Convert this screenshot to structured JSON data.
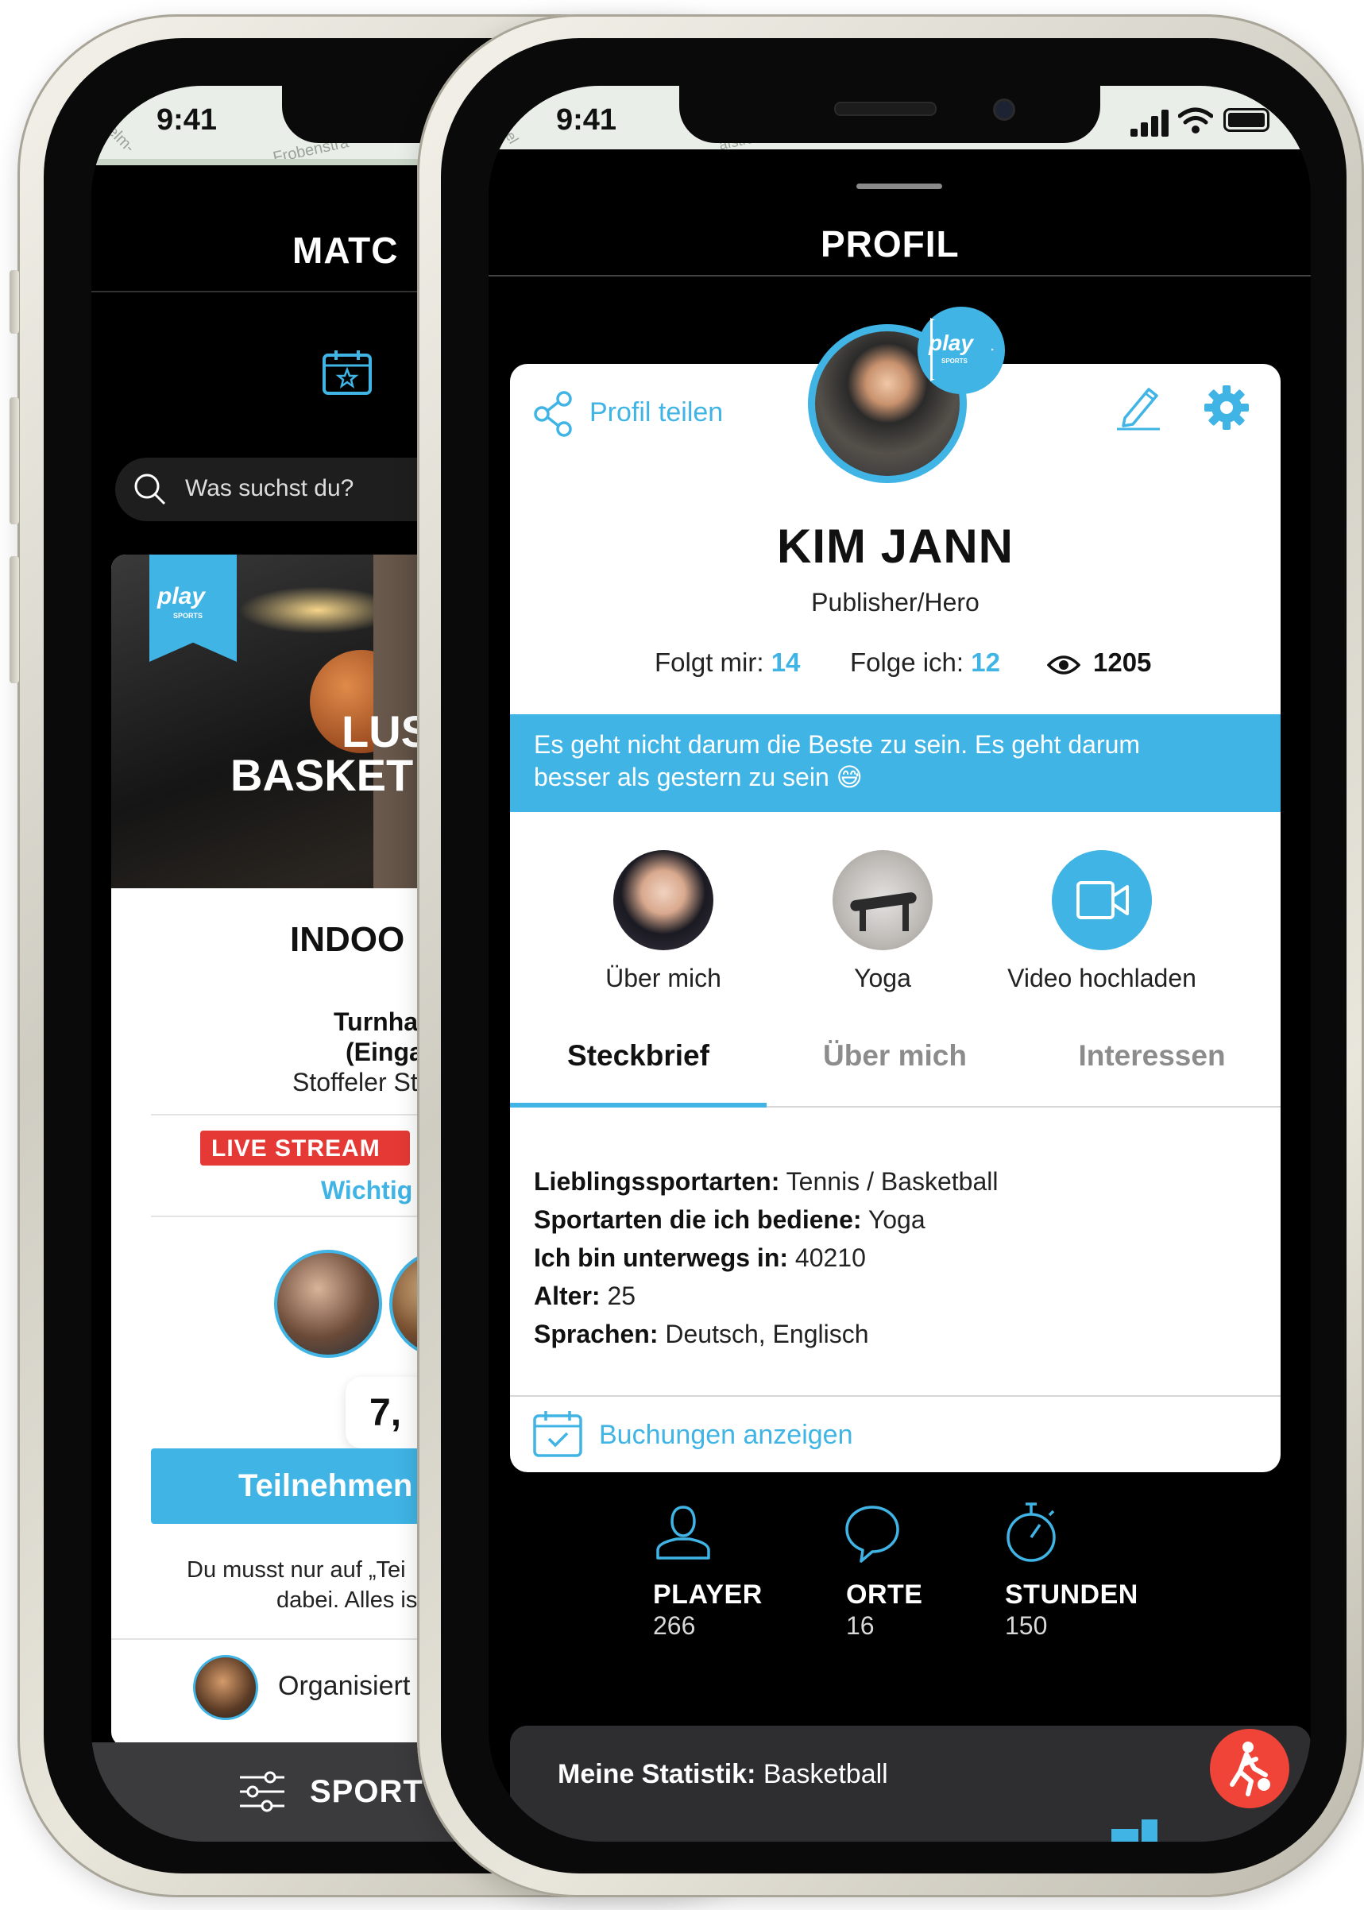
{
  "back_phone": {
    "status_time": "9:41",
    "map_labels": [
      "helm-",
      "Frobenstra"
    ],
    "header_title": "MATC",
    "search_placeholder": "Was suchst du?",
    "hero_line1": "LUS",
    "hero_line2": "BASKET",
    "event_title": "INDOO",
    "venue_line1": "Turnha",
    "venue_line2": "(Einga",
    "venue_line3": "Stoffeler St",
    "live_badge": "LIVE STREAM",
    "important_link": "Wichtig",
    "price": "7,",
    "join_button": "Teilnehmen",
    "hint_line1": "Du musst nur auf „Tei",
    "hint_line2": "dabei. Alles is",
    "organizer": "Organisiert v",
    "bottom_nav_label": "SPORT"
  },
  "front_phone": {
    "status_time": "9:41",
    "map_labels": [
      "rhel",
      "afstra"
    ],
    "header_title": "PROFIL",
    "share_label": "Profil teilen",
    "name": "KIM JANN",
    "role": "Publisher/Hero",
    "followers_label": "Folgt mir:",
    "followers_count": "14",
    "following_label": "Folge ich:",
    "following_count": "12",
    "views": "1205",
    "quote_line1": "Es geht nicht darum die Beste zu sein. Es geht darum",
    "quote_line2": "besser als gestern zu sein 😅",
    "media": [
      {
        "label": "Über mich"
      },
      {
        "label": "Yoga"
      },
      {
        "label": "Video hochladen"
      }
    ],
    "tabs": [
      {
        "label": "Steckbrief",
        "active": true
      },
      {
        "label": "Über mich",
        "active": false
      },
      {
        "label": "Interessen",
        "active": false
      }
    ],
    "profile_rows": [
      {
        "key": "Lieblingssportarten:",
        "value": " Tennis / Basketball"
      },
      {
        "key": "Sportarten die ich bediene:",
        "value": " Yoga"
      },
      {
        "key": "Ich bin unterwegs in:",
        "value": " 40210"
      },
      {
        "key": "Alter:",
        "value": " 25"
      },
      {
        "key": "Sprachen:",
        "value": " Deutsch, Englisch"
      }
    ],
    "bookings_link": "Buchungen anzeigen",
    "stats": [
      {
        "label": "PLAYER",
        "value": "266",
        "icon": "user-icon"
      },
      {
        "label": "ORTE",
        "value": "16",
        "icon": "chat-bubble-icon"
      },
      {
        "label": "STUNDEN",
        "value": "150",
        "icon": "stopwatch-icon"
      }
    ],
    "statistics_label": "Meine Statistik:",
    "statistics_value": " Basketball"
  },
  "brand": {
    "logo_text": "play",
    "logo_sub": "SPORTS",
    "accent": "#3fb4e5",
    "live_red": "#e53935",
    "fab_red": "#f04438"
  }
}
